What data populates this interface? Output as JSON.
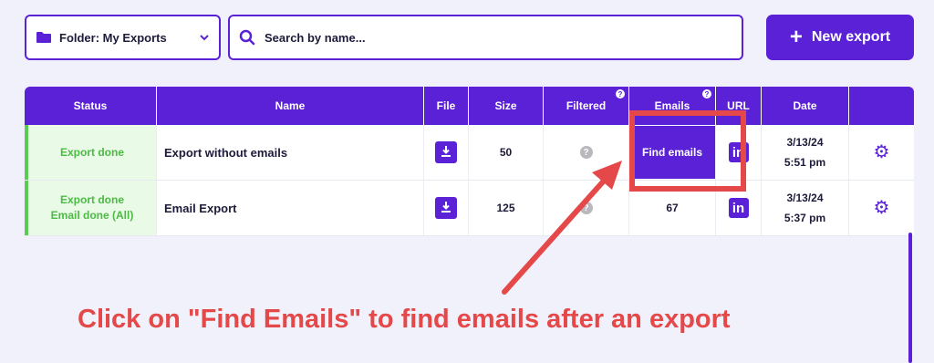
{
  "toolbar": {
    "folder_label": "Folder: My Exports",
    "search_placeholder": "Search by name...",
    "new_export_label": "New export",
    "folder_icon": "folder-icon",
    "search_icon": "search-icon",
    "add_icon": "plus-icon"
  },
  "colors": {
    "accent": "#5b21d6",
    "status_bg": "#e9fbe6",
    "status_text": "#4cba45",
    "annotation": "#e54848"
  },
  "table": {
    "headers": [
      "Status",
      "Name",
      "File",
      "Size",
      "Filtered",
      "Emails",
      "URL",
      "Date",
      ""
    ],
    "help_icon": "?",
    "rows": [
      {
        "status_line1": "Export done",
        "status_line2": "",
        "name": "Export without emails",
        "size": "50",
        "filtered_icon": "?",
        "emails_button": "Find emails",
        "url_icon": "in",
        "date": "3/13/24",
        "time": "5:51 pm"
      },
      {
        "status_line1": "Export done",
        "status_line2": "Email done (All)",
        "name": "Email Export",
        "size": "125",
        "filtered_icon": "?",
        "emails": "67",
        "url_icon": "in",
        "date": "3/13/24",
        "time": "5:37 pm"
      }
    ]
  },
  "annotation": {
    "text": "Click on \"Find Emails\" to find emails after an export"
  }
}
